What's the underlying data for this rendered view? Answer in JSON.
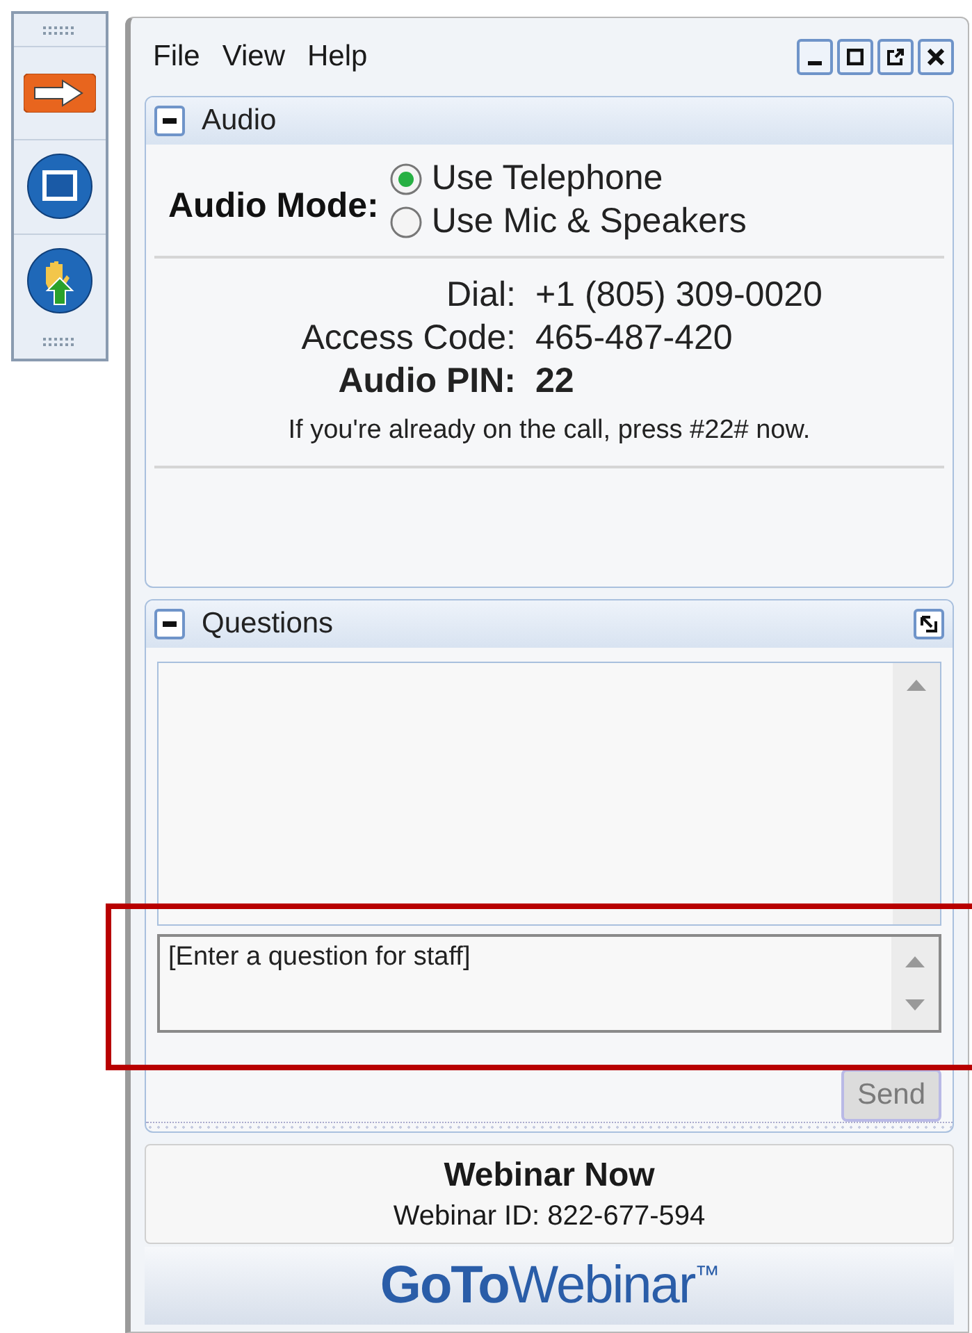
{
  "menu": [
    "File",
    "View",
    "Help"
  ],
  "audio": {
    "title": "Audio",
    "mode_label": "Audio Mode:",
    "modes": [
      {
        "label": "Use Telephone",
        "selected": true
      },
      {
        "label": "Use Mic & Speakers",
        "selected": false
      }
    ],
    "details": [
      {
        "label": "Dial:",
        "value": "+1 (805) 309-0020",
        "bold": false
      },
      {
        "label": "Access Code:",
        "value": "465-487-420",
        "bold": false
      },
      {
        "label": "Audio PIN:",
        "value": "22",
        "bold": true
      }
    ],
    "note": "If you're already on the call, press #22# now."
  },
  "questions": {
    "title": "Questions",
    "input_placeholder": "[Enter a question for staff]",
    "send": {
      "label": "Send",
      "disabled": true
    }
  },
  "webinar": {
    "title": "Webinar Now",
    "id": "Webinar ID: 822-677-594"
  },
  "logo": "**GoTo**Webinar$^{™}$"
}
